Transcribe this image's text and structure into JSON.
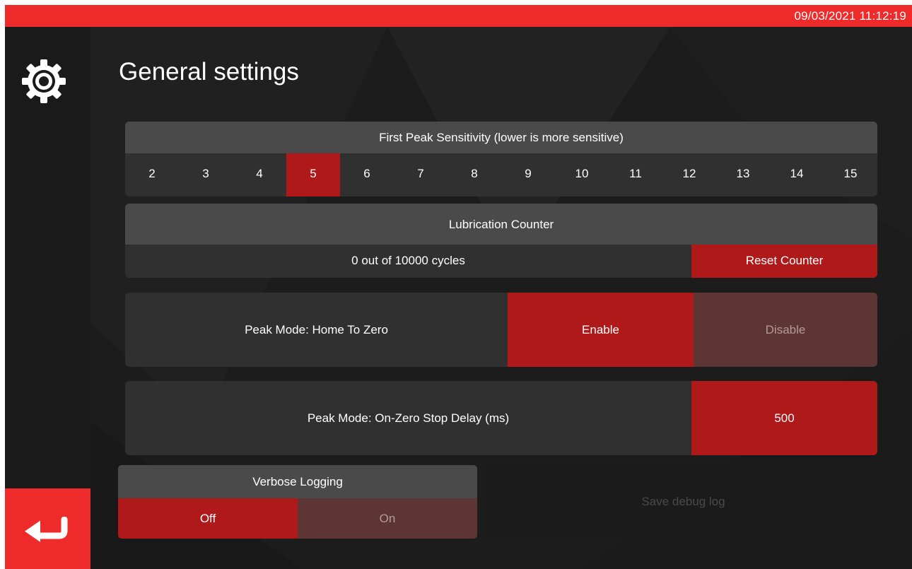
{
  "status_bar": {
    "datetime": "09/03/2021 11:12:19"
  },
  "icons": {
    "header": "gear-icon",
    "back": "return-arrow-icon"
  },
  "colors": {
    "accent": "#ee2a2a",
    "selected": "#b01919",
    "inactive": "#5e3535",
    "panel": "#303030",
    "panel_header": "#4a4a4a"
  },
  "page": {
    "title": "General settings"
  },
  "sensitivity": {
    "title": "First Peak Sensitivity (lower is more sensitive)",
    "options": [
      "2",
      "3",
      "4",
      "5",
      "6",
      "7",
      "8",
      "9",
      "10",
      "11",
      "12",
      "13",
      "14",
      "15"
    ],
    "selected": "5"
  },
  "lubrication": {
    "title": "Lubrication Counter",
    "status": "0 out of 10000 cycles",
    "reset_label": "Reset Counter"
  },
  "home_to_zero": {
    "label": "Peak Mode: Home To Zero",
    "enable_label": "Enable",
    "disable_label": "Disable",
    "selected": "Enable"
  },
  "stop_delay": {
    "label": "Peak Mode: On-Zero Stop Delay (ms)",
    "value": "500"
  },
  "verbose_logging": {
    "title": "Verbose Logging",
    "off_label": "Off",
    "on_label": "On",
    "selected": "Off"
  },
  "debug_log": {
    "label": "Save debug log"
  }
}
